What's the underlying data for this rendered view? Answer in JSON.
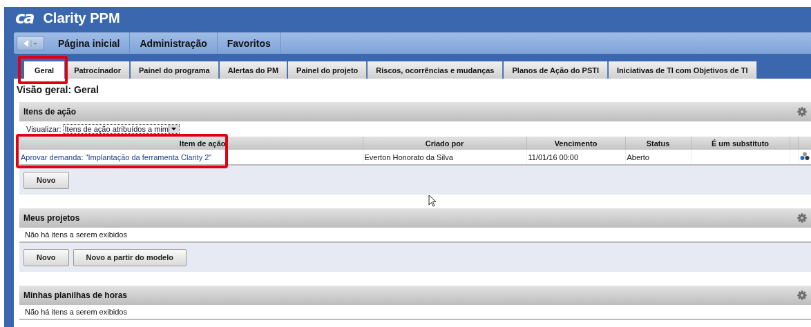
{
  "app": {
    "logo": "ca",
    "title": "Clarity PPM"
  },
  "nav": {
    "items": [
      "Página inicial",
      "Administração",
      "Favoritos"
    ]
  },
  "tabs": [
    {
      "label": "Geral",
      "selected": true,
      "highlighted": true
    },
    {
      "label": "Patrocinador",
      "selected": false,
      "highlighted": false
    },
    {
      "label": "Painel do programa",
      "selected": false,
      "highlighted": false
    },
    {
      "label": "Alertas do PM",
      "selected": false,
      "highlighted": false
    },
    {
      "label": "Painel do projeto",
      "selected": false,
      "highlighted": false
    },
    {
      "label": "Riscos, ocorrências e mudanças",
      "selected": false,
      "highlighted": false
    },
    {
      "label": "Planos de Ação do PSTI",
      "selected": false,
      "highlighted": false
    },
    {
      "label": "Iniciativas de TI com Objetivos de TI",
      "selected": false,
      "highlighted": false
    }
  ],
  "page_title": "Visão geral: Geral",
  "portlets": [
    {
      "title": "Itens de ação",
      "view_label": "Visualizar:",
      "view_value": "Itens de ação atribuídos a mim",
      "columns": [
        {
          "label": "Item de ação",
          "highlighted": true
        },
        {
          "label": "Criado por",
          "highlighted": false
        },
        {
          "label": "Vencimento",
          "highlighted": false
        },
        {
          "label": "Status",
          "highlighted": false
        },
        {
          "label": "É um substituto",
          "highlighted": false
        }
      ],
      "rows": [
        {
          "cells": [
            "Aprovar demanda: \"Implantação da ferramenta Clarity 2\"",
            "Everton Honorato da Silva",
            "11/01/16 00:00",
            "Aberto"
          ]
        }
      ],
      "buttons": [
        "Novo"
      ]
    },
    {
      "title": "Meus projetos",
      "empty_message": "Não há itens a serem exibidos",
      "buttons": [
        "Novo",
        "Novo a partir do modelo"
      ]
    },
    {
      "title": "Minhas planilhas de horas",
      "empty_message": "Não há itens a serem exibidos"
    }
  ]
}
